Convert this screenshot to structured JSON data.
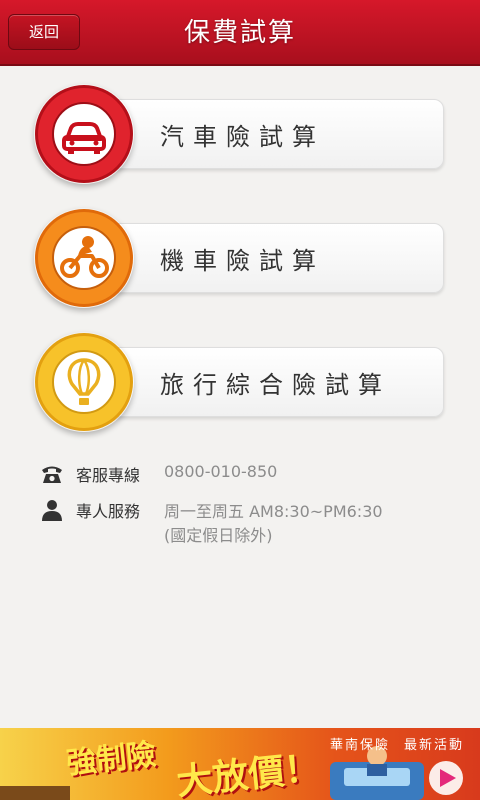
{
  "header": {
    "back_label": "返回",
    "title": "保費試算"
  },
  "menu": [
    {
      "label": "汽車險試算",
      "icon": "car-icon",
      "color": "#d9141f"
    },
    {
      "label": "機車險試算",
      "icon": "motorcycle-icon",
      "color": "#f07d11"
    },
    {
      "label": "旅行綜合險試算",
      "icon": "hot-air-balloon-icon",
      "color": "#f2b01a"
    }
  ],
  "contact": {
    "hotline_label": "客服專線",
    "hotline_value": "0800-010-850",
    "service_label": "專人服務",
    "service_hours": "周一至周五 AM8:30~PM6:30",
    "service_note": "(國定假日除外)"
  },
  "banner": {
    "headline_1": "強制險",
    "headline_2": "大放價！",
    "brand": "華南保險",
    "tagline": "最新活動"
  }
}
